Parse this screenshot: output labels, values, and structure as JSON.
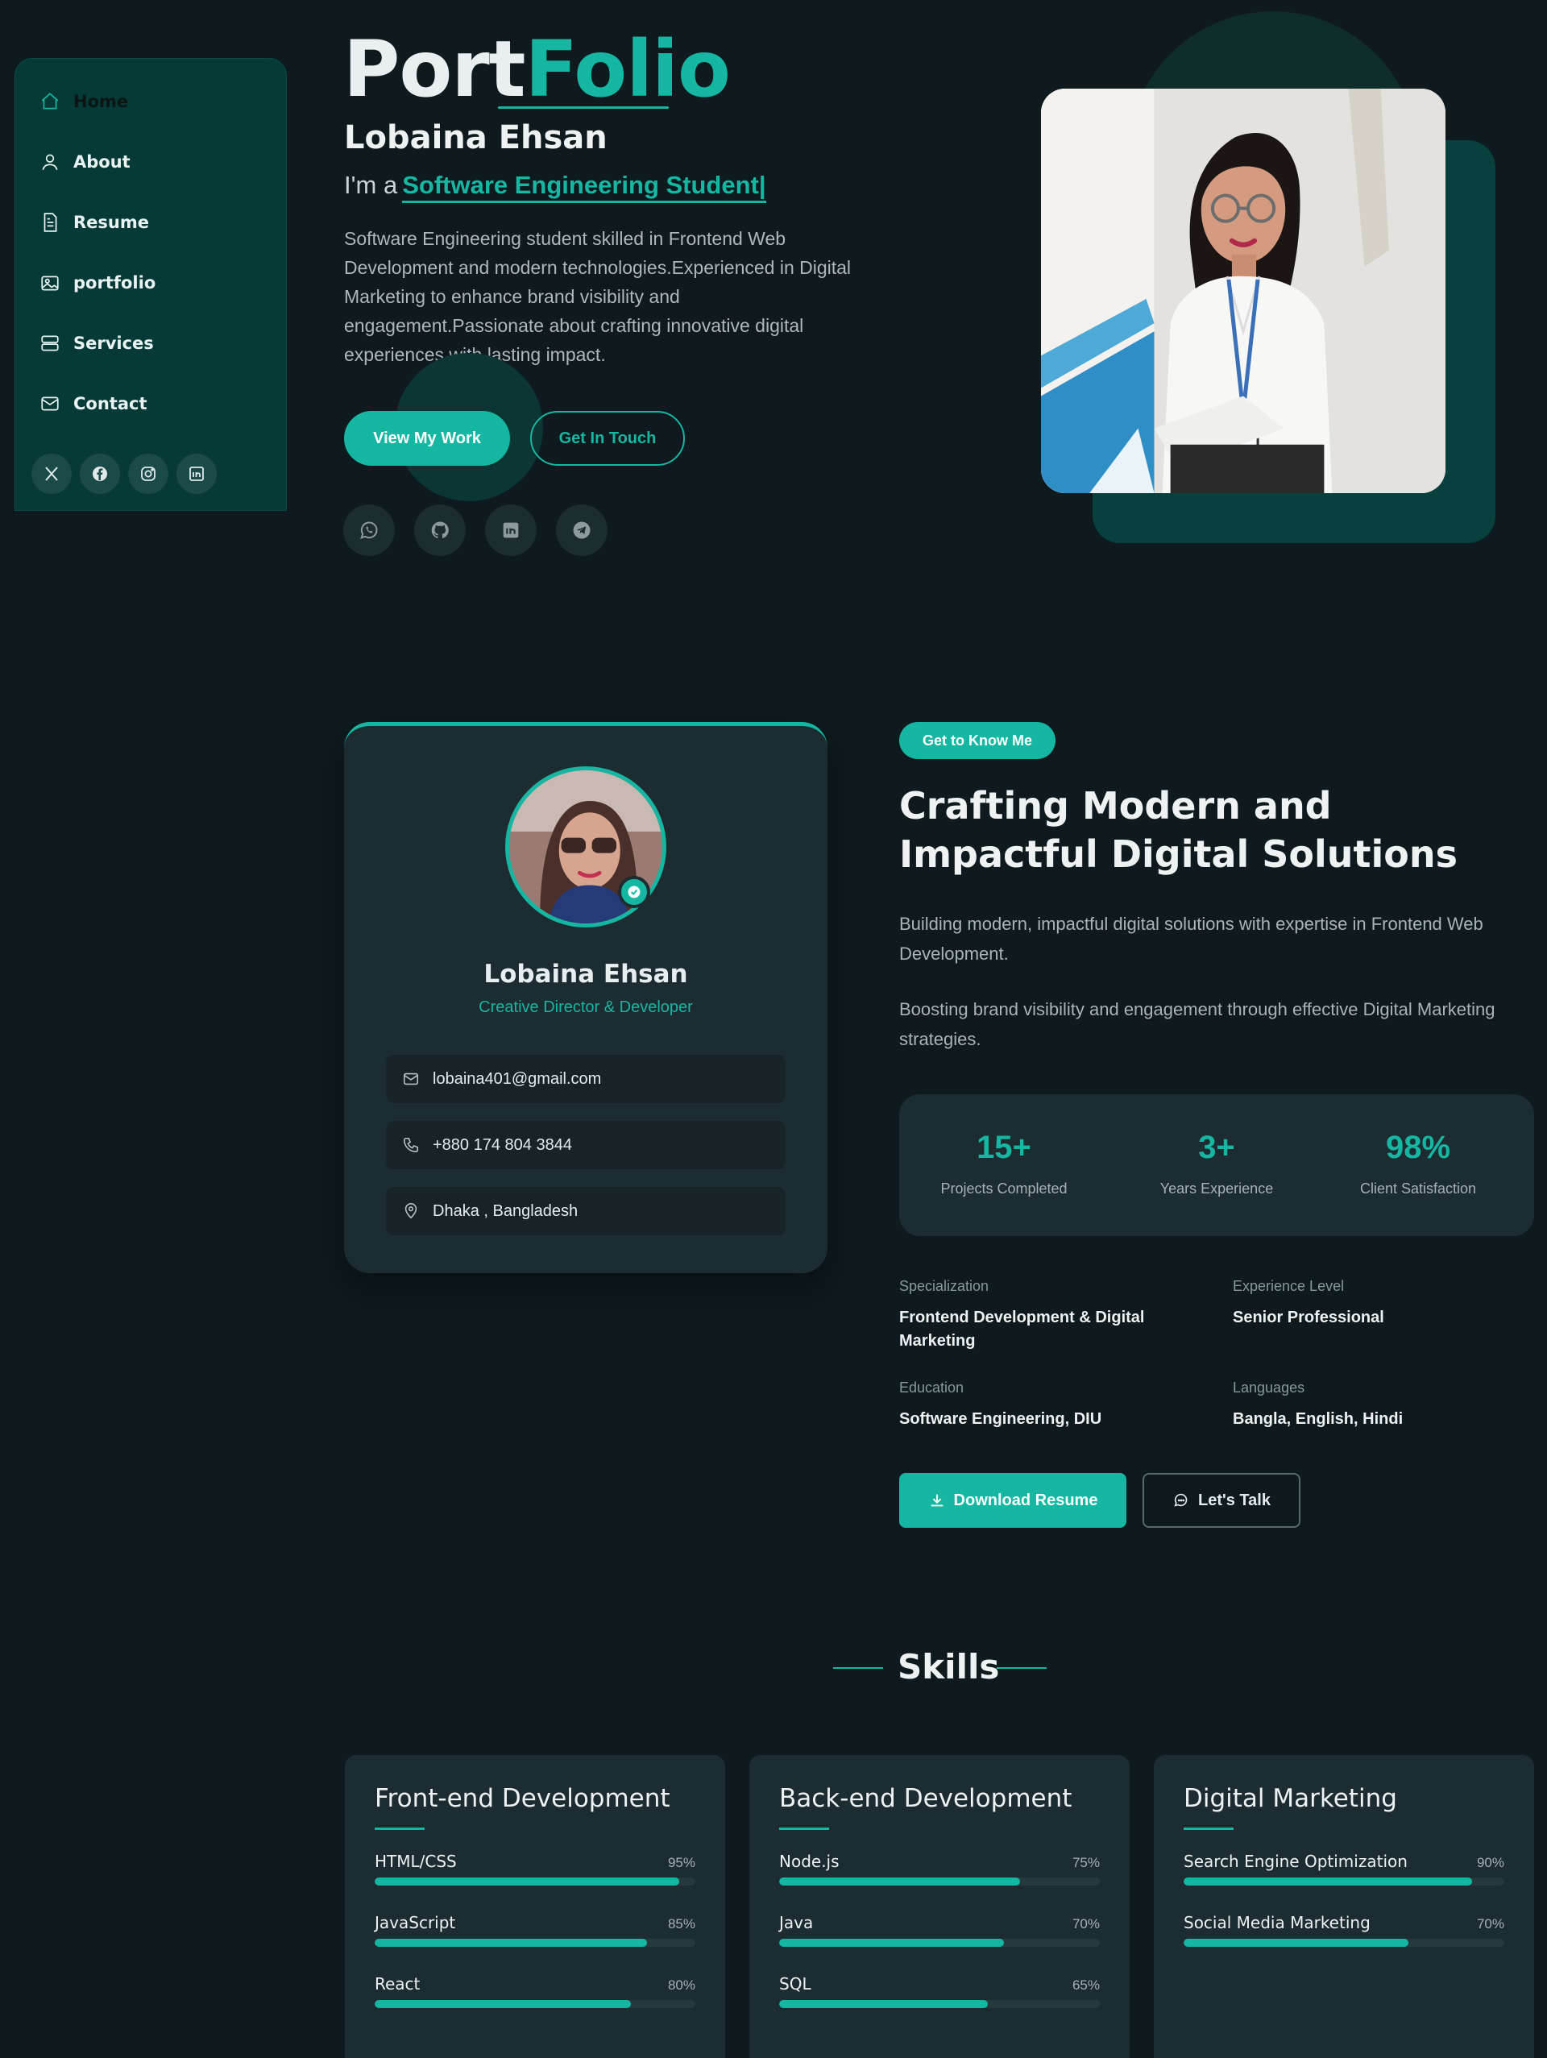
{
  "sidebar": {
    "items": [
      {
        "label": "Home",
        "icon": "home-icon"
      },
      {
        "label": "About",
        "icon": "user-icon"
      },
      {
        "label": "Resume",
        "icon": "document-icon"
      },
      {
        "label": "portfolio",
        "icon": "image-icon"
      },
      {
        "label": "Services",
        "icon": "server-icon"
      },
      {
        "label": "Contact",
        "icon": "mail-icon"
      }
    ],
    "social": [
      "x-icon",
      "facebook-icon",
      "instagram-icon",
      "linkedin-icon"
    ]
  },
  "hero": {
    "logo_part1": "Port",
    "logo_part2": "Folio",
    "name": "Lobaina Ehsan",
    "role_prefix": "I'm a",
    "role": "Software Engineering Student|",
    "description": "Software Engineering student skilled in Frontend Web Development and modern technologies.Experienced in Digital Marketing to enhance brand visibility and engagement.Passionate about crafting innovative digital experiences with lasting impact.",
    "btn_primary": "View My Work",
    "btn_secondary": "Get In Touch",
    "social": [
      "whatsapp-icon",
      "github-icon",
      "linkedin-icon",
      "telegram-icon"
    ]
  },
  "profile": {
    "name": "Lobaina Ehsan",
    "role": "Creative Director & Developer",
    "email": "lobaina401@gmail.com",
    "phone": "+880 174 804 3844",
    "location": "Dhaka , Bangladesh"
  },
  "about": {
    "badge": "Get to Know Me",
    "title": "Crafting Modern and Impactful Digital Solutions",
    "p1": "Building modern, impactful digital solutions with expertise in Frontend Web Development.",
    "p2": "Boosting brand visibility and engagement through effective Digital Marketing strategies.",
    "stats": [
      {
        "value": "15+",
        "label": "Projects Completed"
      },
      {
        "value": "3+",
        "label": "Years Experience"
      },
      {
        "value": "98%",
        "label": "Client Satisfaction"
      }
    ],
    "details": [
      {
        "key": "Specialization",
        "value": "Frontend Development & Digital Marketing"
      },
      {
        "key": "Experience Level",
        "value": "Senior Professional"
      },
      {
        "key": "Education",
        "value": "Software Engineering, DIU"
      },
      {
        "key": "Languages",
        "value": "Bangla, English, Hindi"
      }
    ],
    "btn_download": "Download Resume",
    "btn_talk": "Let's Talk"
  },
  "skills": {
    "title": "Skills",
    "cards": [
      {
        "title": "Front-end Development",
        "items": [
          {
            "name": "HTML/CSS",
            "percent_label": "95%",
            "value": 95
          },
          {
            "name": "JavaScript",
            "percent_label": "85%",
            "value": 85
          },
          {
            "name": "React",
            "percent_label": "80%",
            "value": 80
          }
        ]
      },
      {
        "title": "Back-end Development",
        "items": [
          {
            "name": "Node.js",
            "percent_label": "75%",
            "value": 75
          },
          {
            "name": "Java",
            "percent_label": "70%",
            "value": 70
          },
          {
            "name": "SQL",
            "percent_label": "65%",
            "value": 65
          }
        ]
      },
      {
        "title": "Digital Marketing",
        "items": [
          {
            "name": "Search Engine Optimization",
            "percent_label": "90%",
            "value": 90
          },
          {
            "name": "Social Media Marketing",
            "percent_label": "70%",
            "value": 70
          }
        ]
      }
    ]
  },
  "colors": {
    "accent": "#15b7a3",
    "background": "#0e1a1d",
    "sidebar": "#063a37",
    "card": "#1c2c30"
  }
}
